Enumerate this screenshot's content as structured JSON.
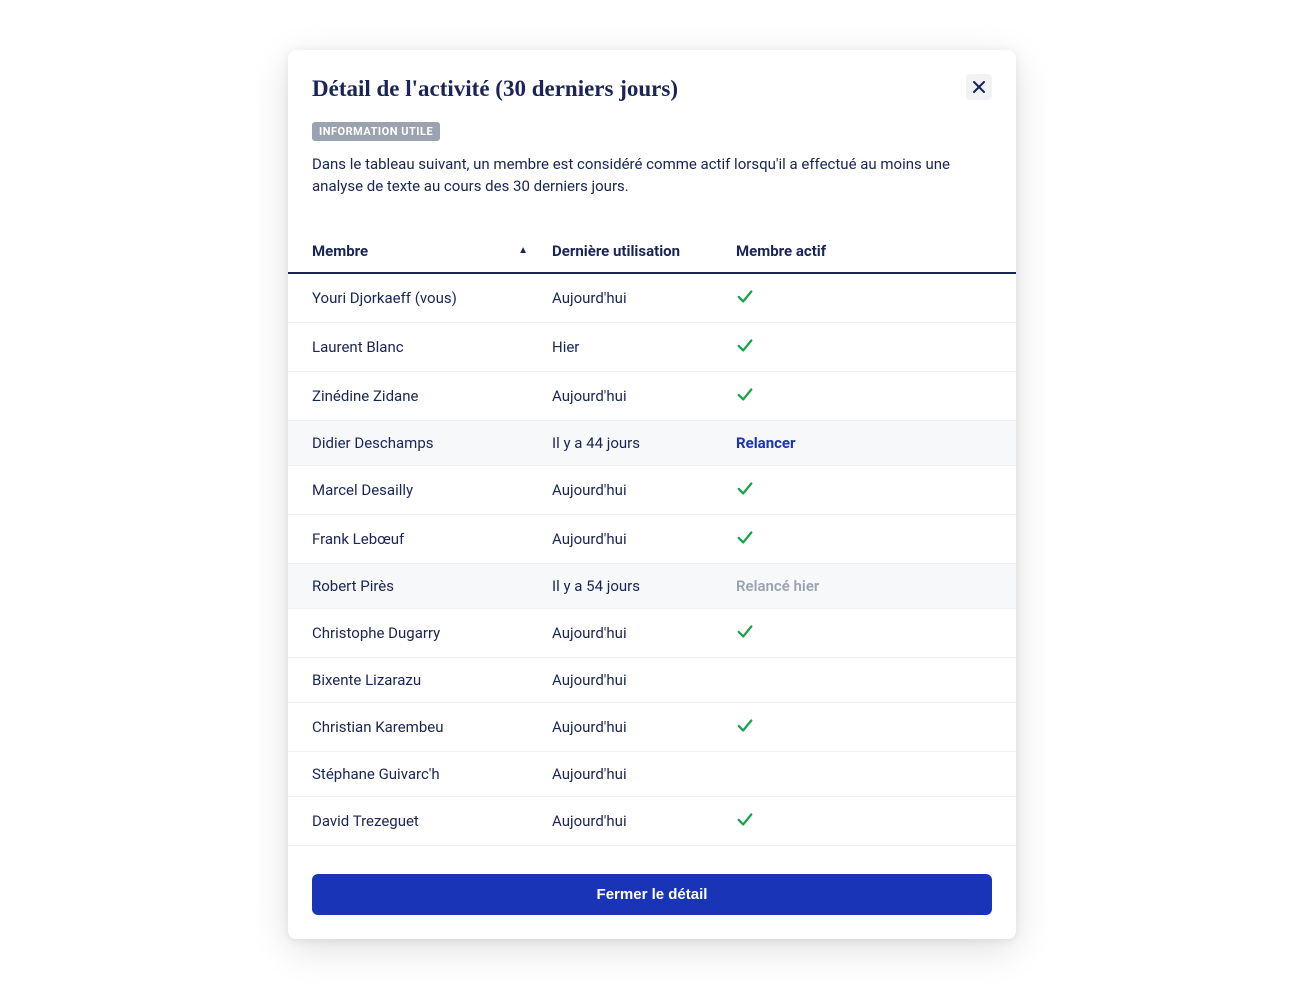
{
  "modal": {
    "title": "Détail de l'activité (30 derniers jours)",
    "infoBadge": "INFORMATION UTILE",
    "infoText": "Dans le tableau suivant, un membre est considéré comme actif lorsqu'il a effectué au moins une analyse de texte au cours des 30 derniers jours.",
    "closeButtonLabel": "Fermer le détail"
  },
  "table": {
    "headers": {
      "member": "Membre",
      "lastUse": "Dernière utilisation",
      "active": "Membre actif"
    },
    "rows": [
      {
        "name": "Youri Djorkaeff (vous)",
        "lastUse": "Aujourd'hui",
        "status": "check"
      },
      {
        "name": "Laurent Blanc",
        "lastUse": "Hier",
        "status": "check"
      },
      {
        "name": "Zinédine Zidane",
        "lastUse": "Aujourd'hui",
        "status": "check"
      },
      {
        "name": "Didier Deschamps",
        "lastUse": "Il y a 44 jours",
        "status": "relancer",
        "statusText": "Relancer"
      },
      {
        "name": "Marcel Desailly",
        "lastUse": "Aujourd'hui",
        "status": "check"
      },
      {
        "name": "Frank Lebœuf",
        "lastUse": "Aujourd'hui",
        "status": "check"
      },
      {
        "name": "Robert Pirès",
        "lastUse": "Il y a 54 jours",
        "status": "relance",
        "statusText": "Relancé hier"
      },
      {
        "name": "Christophe Dugarry",
        "lastUse": "Aujourd'hui",
        "status": "check"
      },
      {
        "name": "Bixente Lizarazu",
        "lastUse": "Aujourd'hui",
        "status": "none"
      },
      {
        "name": "Christian Karembeu",
        "lastUse": "Aujourd'hui",
        "status": "check"
      },
      {
        "name": "Stéphane Guivarc'h",
        "lastUse": "Aujourd'hui",
        "status": "none"
      },
      {
        "name": "David Trezeguet",
        "lastUse": "Aujourd'hui",
        "status": "check"
      }
    ]
  }
}
